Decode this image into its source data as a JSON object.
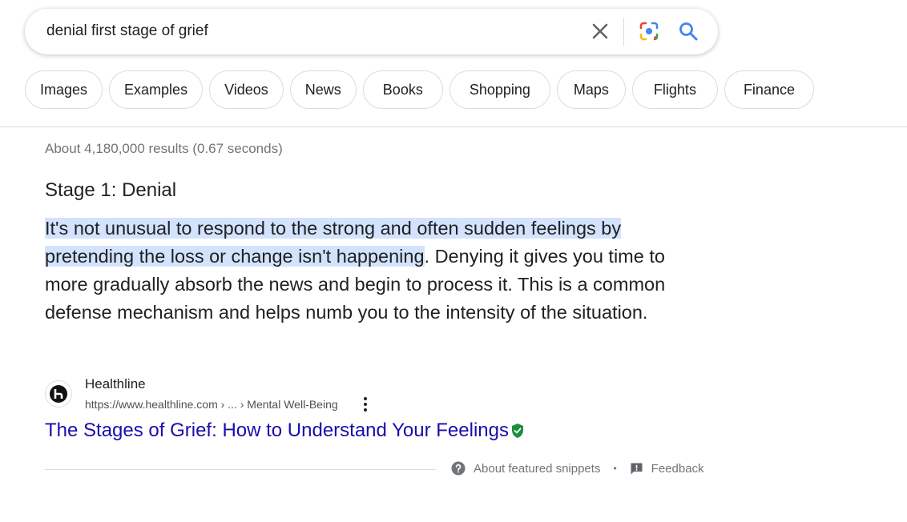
{
  "search": {
    "query": "denial first stage of grief",
    "clear_icon": "close-icon",
    "lens_icon": "google-lens-icon",
    "search_icon": "search-icon"
  },
  "chips": [
    "Images",
    "Examples",
    "Videos",
    "News",
    "Books",
    "Shopping",
    "Maps",
    "Flights",
    "Finance"
  ],
  "results_stats": "About 4,180,000 results (0.67 seconds)",
  "snippet": {
    "heading": "Stage 1: Denial",
    "highlighted_text": "It's not unusual to respond to the strong and often sudden feelings by pretending the loss or change isn't happening",
    "rest_text": ". Denying it gives you time to more gradually absorb the news and begin to process it. This is a common defense mechanism and helps numb you to the intensity of the situation."
  },
  "source": {
    "site_name": "Healthline",
    "url": "https://www.healthline.com › ... › Mental Well-Being",
    "favicon_icon": "healthline-logo-icon",
    "more_icon": "more-vert-icon"
  },
  "result_title": "The Stages of Grief: How to Understand Your Feelings",
  "verified_icon": "verified-shield-icon",
  "footer": {
    "about_label": "About featured snippets",
    "separator": "•",
    "feedback_label": "Feedback"
  },
  "colors": {
    "link": "#1a0dab",
    "highlight": "#d3e3fd",
    "verified": "#1e8e3e",
    "search_blue": "#4285f4"
  }
}
